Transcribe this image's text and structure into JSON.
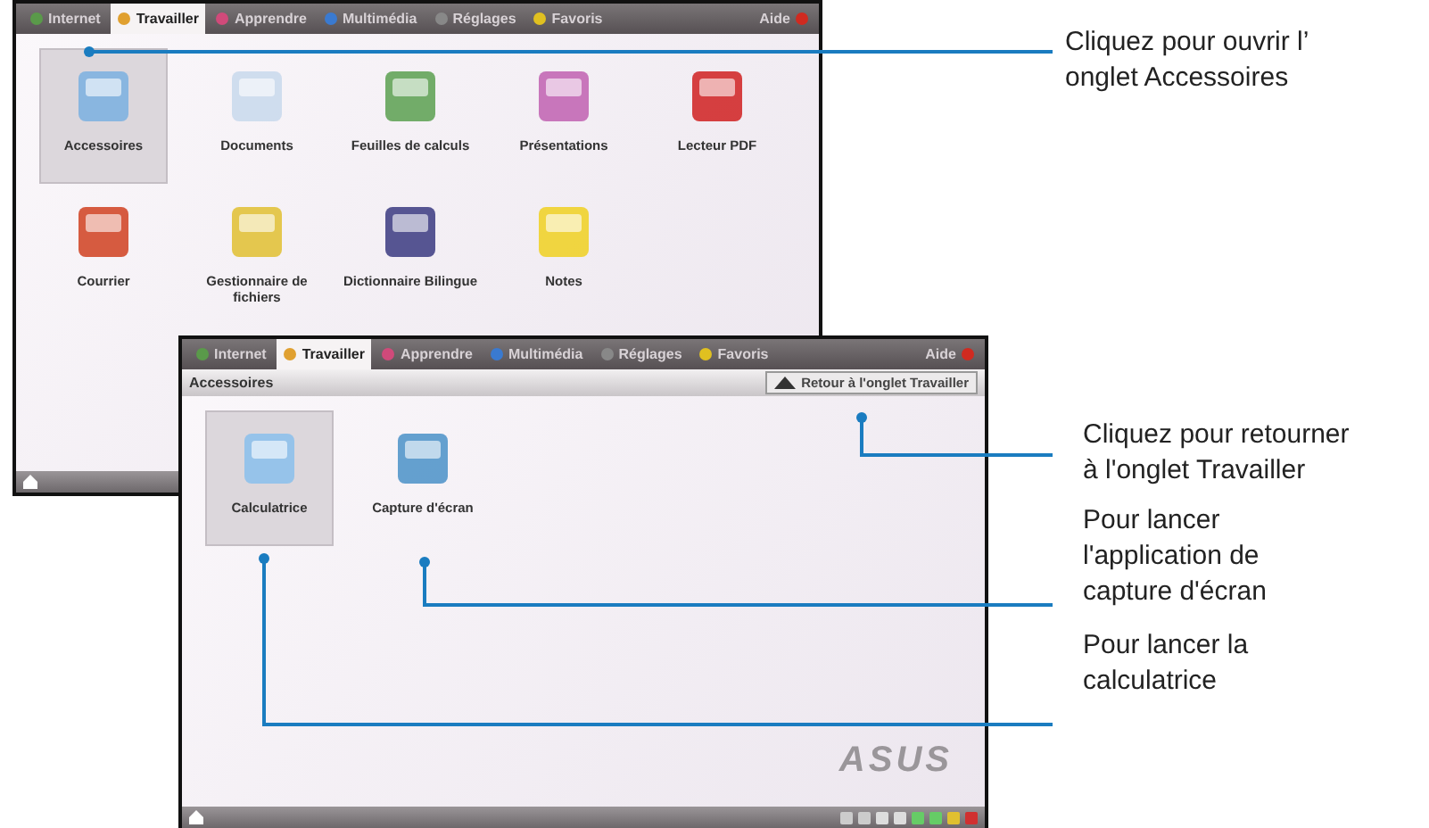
{
  "screens": [
    {
      "tabs": [
        {
          "label": "Internet",
          "selected": false
        },
        {
          "label": "Travailler",
          "selected": true
        },
        {
          "label": "Apprendre",
          "selected": false
        },
        {
          "label": "Multimédia",
          "selected": false
        },
        {
          "label": "Réglages",
          "selected": false
        },
        {
          "label": "Favoris",
          "selected": false
        }
      ],
      "help": "Aide",
      "apps": [
        {
          "label": "Accessoires",
          "selected": true
        },
        {
          "label": "Documents",
          "selected": false
        },
        {
          "label": "Feuilles de calculs",
          "selected": false
        },
        {
          "label": "Présentations",
          "selected": false
        },
        {
          "label": "Lecteur PDF",
          "selected": false
        },
        {
          "label": "Courrier",
          "selected": false
        },
        {
          "label": "Gestionnaire de fichiers",
          "selected": false
        },
        {
          "label": "Dictionnaire Bilingue",
          "selected": false
        },
        {
          "label": "Notes",
          "selected": false
        }
      ]
    },
    {
      "tabs": [
        {
          "label": "Internet",
          "selected": false
        },
        {
          "label": "Travailler",
          "selected": true
        },
        {
          "label": "Apprendre",
          "selected": false
        },
        {
          "label": "Multimédia",
          "selected": false
        },
        {
          "label": "Réglages",
          "selected": false
        },
        {
          "label": "Favoris",
          "selected": false
        }
      ],
      "help": "Aide",
      "header": "Accessoires",
      "back_button": "Retour à l'onglet Travailler",
      "logo": "ASUS",
      "apps": [
        {
          "label": "Calculatrice",
          "selected": true
        },
        {
          "label": "Capture d'écran",
          "selected": false
        }
      ]
    }
  ],
  "callouts": [
    {
      "text": "Cliquez pour ouvrir l’\nonglet Accessoires"
    },
    {
      "text": "Cliquez pour retourner\nà l'onglet Travailler"
    },
    {
      "text": "Pour lancer\nl'application de\ncapture d'écran"
    },
    {
      "text": "Pour lancer la\ncalculatrice"
    }
  ]
}
